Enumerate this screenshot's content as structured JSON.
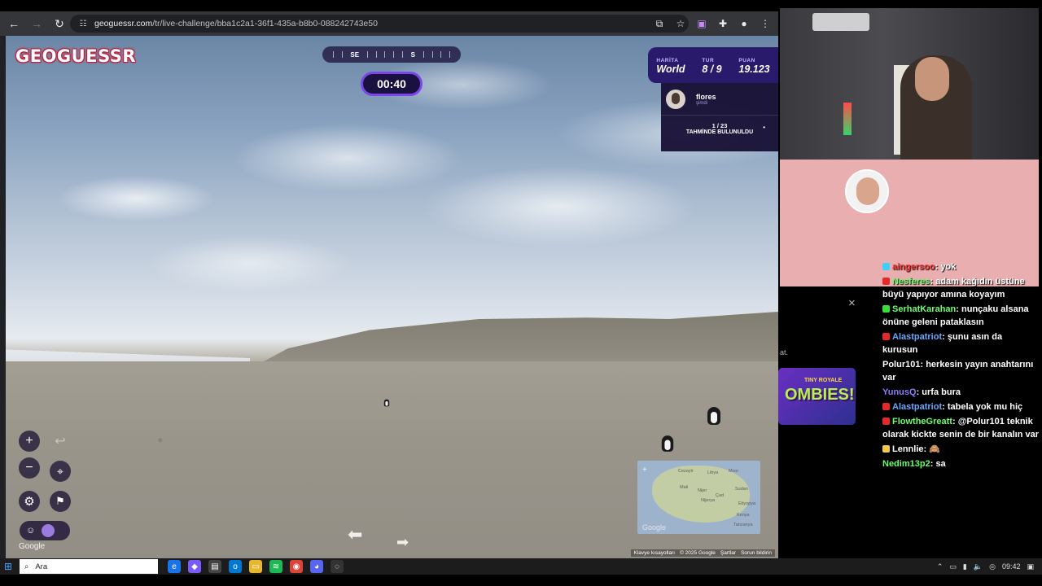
{
  "browser": {
    "url_host": "geoguessr.com",
    "url_path": "/tr/live-challenge/bba1c2a1-36f1-435a-b8b0-088242743e50"
  },
  "game": {
    "logo": "GEOGUESSR",
    "compass": {
      "left": "SE",
      "right": "S"
    },
    "timer": "00:40",
    "status": {
      "map_label": "HARİTA",
      "map_value": "World",
      "round_label": "TUR",
      "round_value": "8 / 9",
      "score_label": "PUAN",
      "score_value": "19.123"
    },
    "player": {
      "name": "flores",
      "sub": "şimdi"
    },
    "found": {
      "count": "1 / 23",
      "label": "TAHMİNDE BULUNULDU",
      "dot": "•"
    },
    "google_watermark": "Google",
    "minimap_google": "Google",
    "footer_links": [
      "Klavye kısayolları",
      "© 2025 Google",
      "Şartlar",
      "Sorun bildirin"
    ]
  },
  "minimap_labels": [
    "Cezayir",
    "Libya",
    "Mısır",
    "Nijer",
    "Çad",
    "Sudan",
    "Etiyopya",
    "Kenya",
    "Tanzanya",
    "Mali",
    "Nijerya"
  ],
  "overlay": {
    "close": "×",
    "cut_text": "at.",
    "promo_sub": "TINY ROYALE",
    "promo_title": "OMBIES!"
  },
  "chat": [
    {
      "user": "aingersoo",
      "text": "yok",
      "color": "#ff3b3b",
      "badge": "#3bd1ff"
    },
    {
      "user": "Nesferes",
      "text": "adam kağıdın üstüne büyü yapıyor amına koyayım",
      "color": "#6bff6b",
      "badge": "#e32a2a"
    },
    {
      "user": "SerhatKarahan",
      "text": "nunçaku alsana önüne geleni pataklasın",
      "color": "#6bff6b",
      "badge": "#3bdc3b"
    },
    {
      "user": "Alastpatriot",
      "text": "şunu asın da kurusun",
      "color": "#6ba8ff",
      "badge": "#e32a2a"
    },
    {
      "user": "Polur101",
      "text": "herkesin yayın anahtarını var",
      "color": "#ffffff",
      "badge": ""
    },
    {
      "user": "YunusQ",
      "text": "urfa bura",
      "color": "#8a7dff",
      "badge": ""
    },
    {
      "user": "Alastpatriot",
      "text": "tabela yok mu hiç",
      "color": "#6ba8ff",
      "badge": "#e32a2a"
    },
    {
      "user": "FlowtheGreatt",
      "text": "@Polur101 teknik olarak kickte senin de bir kanalın var",
      "color": "#6bff6b",
      "badge": "#e32a2a"
    },
    {
      "user": "Lennlie",
      "text": "🙈",
      "color": "#ffffff",
      "badge": "#f2c94c"
    },
    {
      "user": "Nedim13p2",
      "text": "sa",
      "color": "#6bff6b",
      "badge": ""
    }
  ],
  "taskbar": {
    "search_placeholder": "Ara",
    "time": "09:42"
  },
  "colors": {
    "accent_purple": "#7b46e8",
    "status_bg": "#2a1a6b",
    "logo_red": "#c21d3b",
    "pink_panel": "#e8aeb0"
  }
}
